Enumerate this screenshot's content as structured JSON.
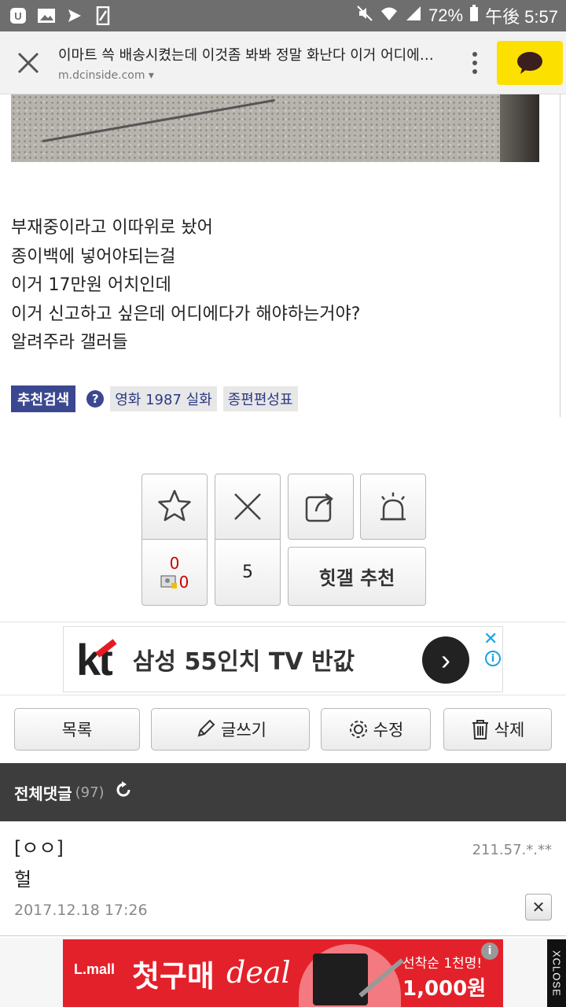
{
  "status_bar": {
    "notification_icons": [
      "app-icon",
      "image-icon",
      "send-icon",
      "file-icon"
    ],
    "right_icons": [
      "mute-icon",
      "wifi-icon",
      "signal-icon"
    ],
    "battery": "72%",
    "time": "午後 5:57"
  },
  "browser": {
    "page_title": "이마트 쓱 배송시켰는데 이것좀 봐봐 정말 화난다 이거 어디에 신고...",
    "domain": "m.dcinside.com",
    "close_icon": "close-icon",
    "menu_icon": "more-vert-icon",
    "share_icon": "kakaotalk-icon",
    "kakao_color": "#fce000"
  },
  "article": {
    "lines": [
      "부재중이라고 이따위로 놨어",
      "종이백에 넣어야되는걸",
      "이거 17만원 어치인데",
      "이거 신고하고 싶은데 어디에다가 해야하는거야?",
      "알려주라 갤러들"
    ],
    "recommend_search_label": "추천검색",
    "tags": [
      "영화 1987 실화",
      "종편편성표"
    ]
  },
  "vote": {
    "recommend_count": "0",
    "fixed_recommend_count": "0",
    "nonrecommend_count": "5",
    "hitgall_label": "힛갤 추천"
  },
  "ad_banner": {
    "brand": "kt",
    "text": "삼성 55인치 TV 반값",
    "close": "✕",
    "info": "i"
  },
  "actions": {
    "list_label": "목록",
    "write_label": "글쓰기",
    "edit_label": "수정",
    "delete_label": "삭제"
  },
  "comments_header": {
    "label": "전체댓글",
    "count": "(97)"
  },
  "comment": {
    "author": "[ㅇㅇ]",
    "ip": "211.57.*.**",
    "text": "헐",
    "date": "2017.12.18 17:26",
    "delete": "✕"
  },
  "bottom_ad": {
    "logo": "L.mall",
    "main": "첫구매",
    "deal": "deal",
    "line1": "선착순 1천명!",
    "line2": "1,000원",
    "info": "i",
    "close": "XCLOSE"
  }
}
